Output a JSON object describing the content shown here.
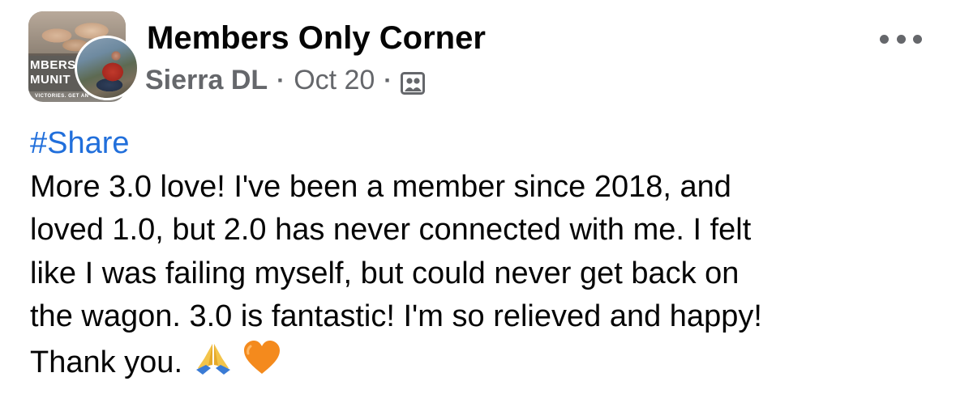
{
  "header": {
    "group_name": "Members Only Corner",
    "author": "Sierra DL",
    "separator": "·",
    "date": "Oct 20",
    "group_avatar_text": "MBERS\nMUNIT",
    "group_avatar_subtext": "VICTORIES. GET AN",
    "audience_icon": "group-photo-icon",
    "more_icon": "more-horizontal-icon"
  },
  "post": {
    "hashtag": "#Share",
    "lines": [
      "More 3.0 love! I've been a member since 2018, and",
      "loved 1.0, but 2.0 has never connected with me. I felt",
      "like I was failing myself, but could never get back on",
      "the wagon. 3.0 is fantastic! I'm so relieved and happy!",
      "Thank you."
    ],
    "emojis": [
      "folded-hands-emoji",
      "orange-heart-emoji"
    ]
  },
  "colors": {
    "text": "#050505",
    "secondary": "#65676b",
    "link": "#216fdb",
    "heart": "#f48a1d"
  }
}
